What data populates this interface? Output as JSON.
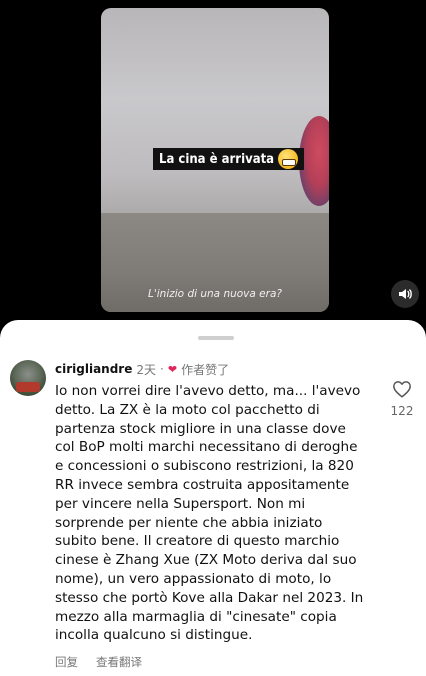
{
  "video": {
    "caption": "La cina è arrivata",
    "subtitle": "L'inizio di una nuova era?"
  },
  "comment": {
    "username": "cirigliandre",
    "time": "2天",
    "separator": "·",
    "author_liked": "作者赞了",
    "text": "Io non vorrei dire l'avevo detto, ma... l'avevo detto. La ZX è la moto col pacchetto di partenza stock migliore in una classe dove col BoP molti marchi necessitano di deroghe e concessioni o subiscono restrizioni, la 820 RR invece sembra costruita appositamente per vincere nella Supersport. Non mi sorprende per niente che abbia iniziato subito bene. Il creatore di questo marchio cinese è Zhang Xue (ZX Moto deriva dal suo nome), un vero appassionato di moto, lo stesso che portò Kove alla Dakar nel 2023. In mezzo alla marmaglia di \"cinesate\" copia incolla qualcuno si distingue.",
    "like_count": "122",
    "reply_label": "回复",
    "translate_label": "查看翻译"
  },
  "icons": {
    "sound": "speaker-icon",
    "like": "heart-outline-icon",
    "author_heart": "heart-filled-icon"
  },
  "colors": {
    "accent_heart": "#e0245e",
    "secondary_text": "#777777"
  }
}
